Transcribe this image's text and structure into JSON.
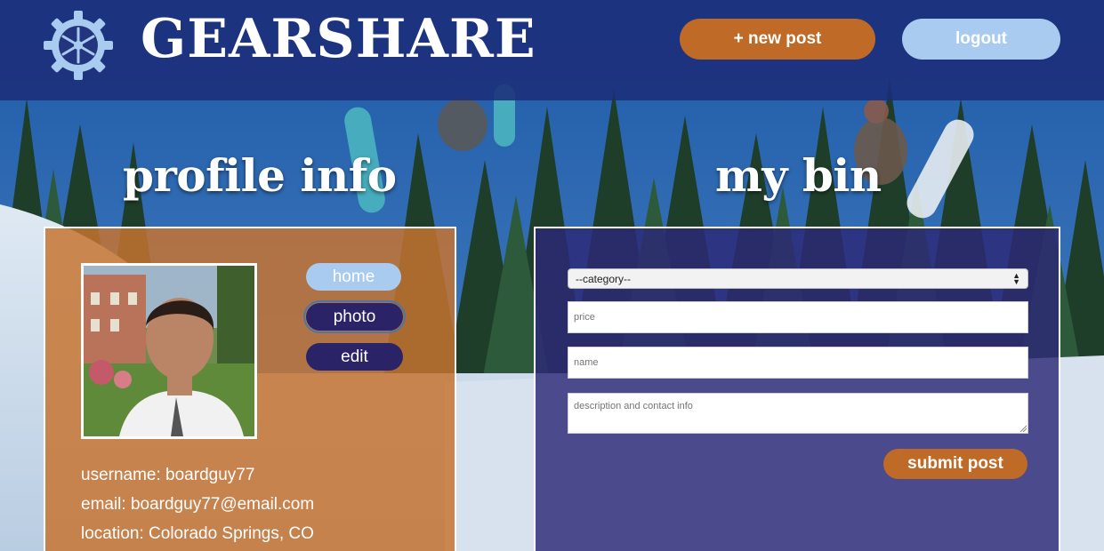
{
  "header": {
    "brand": "GEARSHARE",
    "logo_icon": "gear-snowflake-icon",
    "new_post_label": "+ new post",
    "logout_label": "logout"
  },
  "profile": {
    "title": "profile info",
    "buttons": {
      "home": "home",
      "photo": "photo",
      "edit": "edit"
    },
    "username_line": "username: boardguy77",
    "email_line": "email: boardguy77@email.com",
    "location_line": "location: Colorado Springs, CO"
  },
  "bin": {
    "title": "my bin",
    "category": {
      "selected": "--category--"
    },
    "price_placeholder": "price",
    "name_placeholder": "name",
    "description_placeholder": "description and contact info",
    "submit_label": "submit post"
  },
  "colors": {
    "header_bg": "#1c2c78",
    "accent_orange": "#bf6a26",
    "light_blue": "#a8cbef",
    "navy": "#2b2368"
  }
}
